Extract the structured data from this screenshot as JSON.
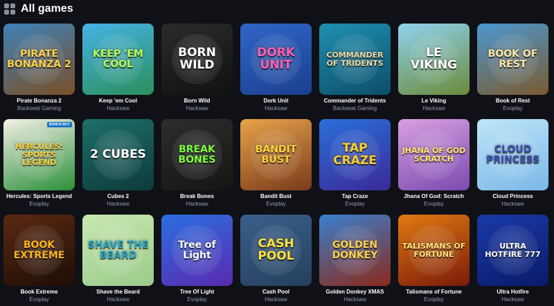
{
  "header": {
    "title": "All games",
    "icon": "grid-icon"
  },
  "games": [
    {
      "name": "Pirate Bonanza 2",
      "provider": "Backseat Gaming",
      "logo": "PIRATE BONANZA 2",
      "bg": "#3f82b8",
      "bg2": "#7a4f26",
      "logo_color": "#ffd24a"
    },
    {
      "name": "Keep 'em Cool",
      "provider": "Hacksaw",
      "logo": "KEEP 'EM COOL",
      "bg": "#46b3e6",
      "bg2": "#2a8f5a",
      "logo_color": "#b9ff5a"
    },
    {
      "name": "Born Wild",
      "provider": "Hacksaw",
      "logo": "BORN WILD",
      "bg": "#2b2b2b",
      "bg2": "#111111",
      "logo_color": "#ffffff"
    },
    {
      "name": "Dork Unit",
      "provider": "Hacksaw",
      "logo": "DORK UNIT",
      "bg": "#2f66c8",
      "bg2": "#1c3f8f",
      "logo_color": "#ff5fb0"
    },
    {
      "name": "Commander of Tridents",
      "provider": "Backseat Gaming",
      "logo": "COMMANDER OF TRIDENTS",
      "bg": "#1f8fb0",
      "bg2": "#0c4f6a",
      "logo_color": "#e8d9a0"
    },
    {
      "name": "Le Viking",
      "provider": "Hacksaw",
      "logo": "LE VIKING",
      "bg": "#8fd3f0",
      "bg2": "#6a8a3a",
      "logo_color": "#ffffff"
    },
    {
      "name": "Book of Rest",
      "provider": "Evoplay",
      "logo": "BOOK OF REST",
      "bg": "#4c98cf",
      "bg2": "#7a5a30",
      "logo_color": "#ffe9a8"
    },
    {
      "name": "Hercules: Sports Legend",
      "provider": "Evoplay",
      "logo": "HERCULES: SPORTS LEGEND",
      "bg": "#f4f0e6",
      "bg2": "#2a8f3a",
      "logo_color": "#ffcf3a",
      "badge": "BONUS BUY"
    },
    {
      "name": "Cubes 2",
      "provider": "Hacksaw",
      "logo": "2 CUBES",
      "bg": "#1d6f6a",
      "bg2": "#0d3b3a",
      "logo_color": "#ffffff"
    },
    {
      "name": "Break Bones",
      "provider": "Hacksaw",
      "logo": "BREAK BONES",
      "bg": "#2d2d2d",
      "bg2": "#151515",
      "logo_color": "#7dff3a"
    },
    {
      "name": "Bandit Bust",
      "provider": "Evoplay",
      "logo": "BANDIT BUST",
      "bg": "#e8a34a",
      "bg2": "#7a3a1a",
      "logo_color": "#ffd33a"
    },
    {
      "name": "Tap Craze",
      "provider": "Evoplay",
      "logo": "TAP CRAZE",
      "bg": "#2a6fd8",
      "bg2": "#3a2a9a",
      "logo_color": "#ffcf2a"
    },
    {
      "name": "Jhana Of God: Scratch",
      "provider": "Evoplay",
      "logo": "JHANA OF GOD SCRATCH",
      "bg": "#d9a0e0",
      "bg2": "#7a4ab0",
      "logo_color": "#ffe66a"
    },
    {
      "name": "Cloud Princess",
      "provider": "Hacksaw",
      "logo": "CLOUD PRINCESS",
      "bg": "#bfe4f8",
      "bg2": "#7ab8e8",
      "logo_color": "#3a4fb0"
    },
    {
      "name": "Book Extreme",
      "provider": "Evoplay",
      "logo": "BOOK EXTREME",
      "bg": "#5a2a12",
      "bg2": "#1e0d06",
      "logo_color": "#ffb320"
    },
    {
      "name": "Shave the Beard",
      "provider": "Hacksaw",
      "logo": "SHAVE THE BEARD",
      "bg": "#c8e8b0",
      "bg2": "#9acb8a",
      "logo_color": "#2aa6c8"
    },
    {
      "name": "Tree Of Light",
      "provider": "Evoplay",
      "logo": "Tree of Light",
      "bg": "#2a6fe0",
      "bg2": "#5a2ab0",
      "logo_color": "#ffffff"
    },
    {
      "name": "Cash Pool",
      "provider": "Hacksaw",
      "logo": "CASH POOL",
      "bg": "#3a5f8a",
      "bg2": "#24405e",
      "logo_color": "#ffe23a"
    },
    {
      "name": "Golden Donkey XMAS",
      "provider": "Hacksaw",
      "logo": "GOLDEN DONKEY",
      "bg": "#3a7fd0",
      "bg2": "#8a2a1a",
      "logo_color": "#ffd24a"
    },
    {
      "name": "Talismans of Fortune",
      "provider": "Evoplay",
      "logo": "TALISMANS OF FORTUNE",
      "bg": "#e07a12",
      "bg2": "#7a1a0a",
      "logo_color": "#ffe27a"
    },
    {
      "name": "Ultra Hotfire",
      "provider": "Hacksaw",
      "logo": "ULTRA HOTFIRE 777",
      "bg": "#1a3aa8",
      "bg2": "#0a1a6a",
      "logo_color": "#ffffff"
    }
  ]
}
